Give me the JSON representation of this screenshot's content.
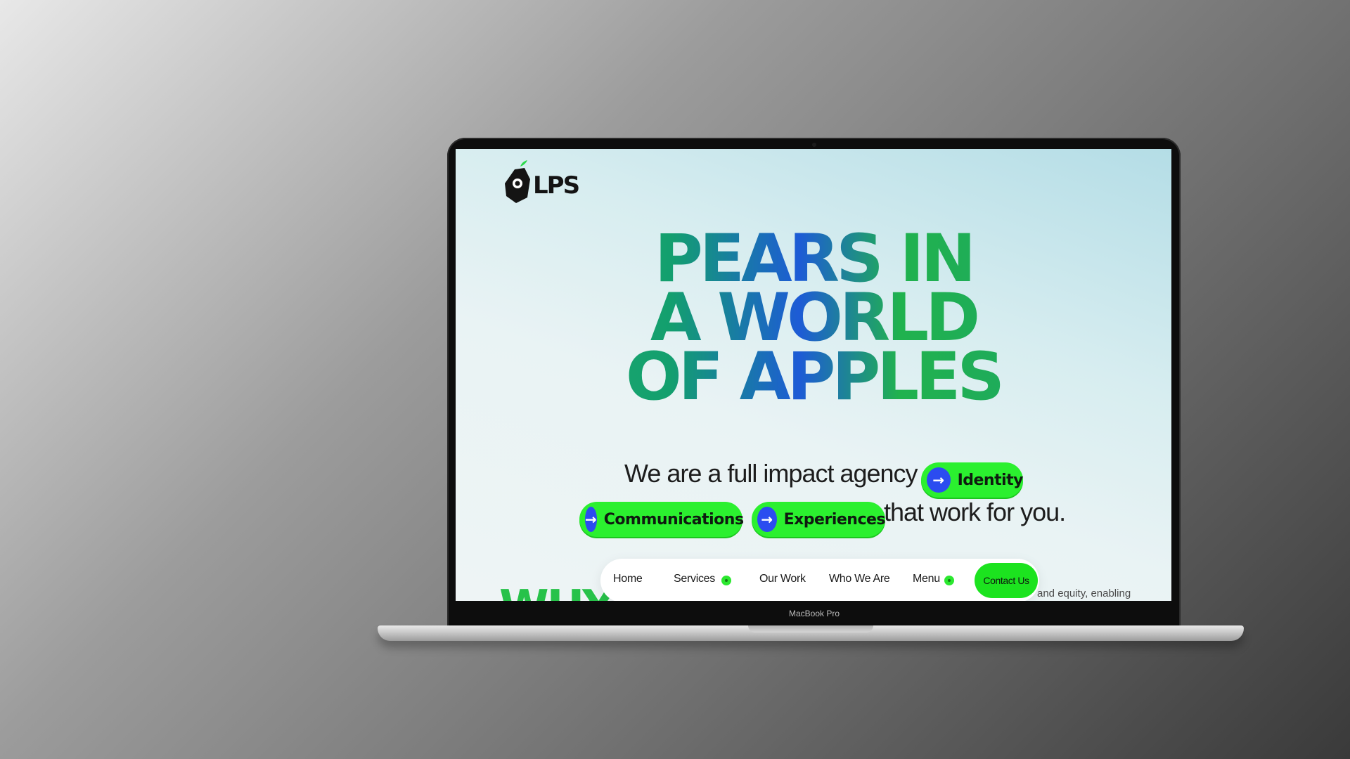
{
  "device": {
    "model_label": "MacBook Pro"
  },
  "site": {
    "logo_text": "LPS",
    "headline": [
      "PEARS IN",
      "A WORLD",
      "OF APPLES"
    ],
    "tagline_start": "We are a full impact agency",
    "tagline_end": "that work for you.",
    "pills": [
      {
        "label": "Identity",
        "icon": "arrow-right-icon"
      },
      {
        "label": "Communications",
        "icon": "arrow-right-icon"
      },
      {
        "label": "Experiences",
        "icon": "arrow-right-icon"
      }
    ],
    "peek_heading": "WHY",
    "side_text": "and equity, enabling"
  },
  "nav": {
    "items": [
      {
        "label": "Home"
      },
      {
        "label": "Services",
        "has_dropdown": true
      },
      {
        "label": "Our Work"
      },
      {
        "label": "Who We Are"
      },
      {
        "label": "Menu",
        "has_dropdown": true
      }
    ],
    "contact_label": "Contact Us"
  },
  "colors": {
    "accent_green": "#2bf02f",
    "accent_blue": "#2b4cf0",
    "headline_green": "#1ca06e",
    "headline_blue": "#1d5bd6"
  }
}
